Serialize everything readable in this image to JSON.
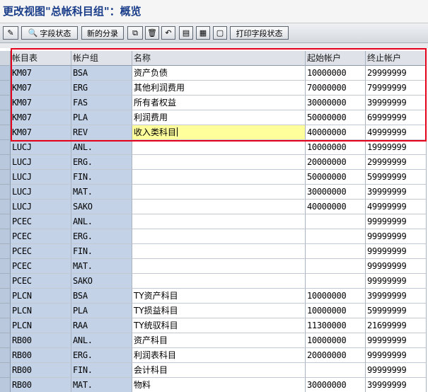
{
  "window": {
    "title": "更改视图\"总帐科目组\"：概览"
  },
  "toolbar": {
    "field_status_label": "字段状态",
    "new_entries_label": "新的分录",
    "print_field_status_label": "打印字段状态"
  },
  "table": {
    "columns": [
      "帐目表",
      "帐户组",
      "名称",
      "起始帐户",
      "终止帐户"
    ],
    "rows": [
      [
        "KM07",
        "BSA",
        "资产负债",
        "10000000",
        "29999999"
      ],
      [
        "KM07",
        "ERG",
        "其他利润费用",
        "70000000",
        "79999999"
      ],
      [
        "KM07",
        "FAS",
        "所有者权益",
        "30000000",
        "39999999"
      ],
      [
        "KM07",
        "PLA",
        "利润费用",
        "50000000",
        "69999999"
      ],
      [
        "KM07",
        "REV",
        "收入类科目",
        "40000000",
        "49999999"
      ],
      [
        "LUCJ",
        "ANL.",
        "",
        "10000000",
        "19999999"
      ],
      [
        "LUCJ",
        "ERG.",
        "",
        "20000000",
        "29999999"
      ],
      [
        "LUCJ",
        "FIN.",
        "",
        "50000000",
        "59999999"
      ],
      [
        "LUCJ",
        "MAT.",
        "",
        "30000000",
        "39999999"
      ],
      [
        "LUCJ",
        "SAKO",
        "",
        "40000000",
        "49999999"
      ],
      [
        "PCEC",
        "ANL.",
        "",
        "",
        "99999999"
      ],
      [
        "PCEC",
        "ERG.",
        "",
        "",
        "99999999"
      ],
      [
        "PCEC",
        "FIN.",
        "",
        "",
        "99999999"
      ],
      [
        "PCEC",
        "MAT.",
        "",
        "",
        "99999999"
      ],
      [
        "PCEC",
        "SAKO",
        "",
        "",
        "99999999"
      ],
      [
        "PLCN",
        "BSA",
        "TY资产科目",
        "10000000",
        "39999999"
      ],
      [
        "PLCN",
        "PLA",
        "TY损益科目",
        "10000000",
        "59999999"
      ],
      [
        "PLCN",
        "RAA",
        "TY统驭科目",
        "11300000",
        "21699999"
      ],
      [
        "RB00",
        "ANL.",
        "资产科目",
        "10000000",
        "99999999"
      ],
      [
        "RB00",
        "ERG.",
        "利润表科目",
        "20000000",
        "99999999"
      ],
      [
        "RB00",
        "FIN.",
        "会计科目",
        "",
        "99999999"
      ],
      [
        "RB00",
        "MAT.",
        "物料",
        "30000000",
        "39999999"
      ]
    ],
    "editing_row": 4,
    "editing_color": "#ffff9c"
  },
  "colors": {
    "highlight_border": "#e5001c",
    "title": "#1a3d8a",
    "key_column_bg": "#c3d2e7"
  }
}
